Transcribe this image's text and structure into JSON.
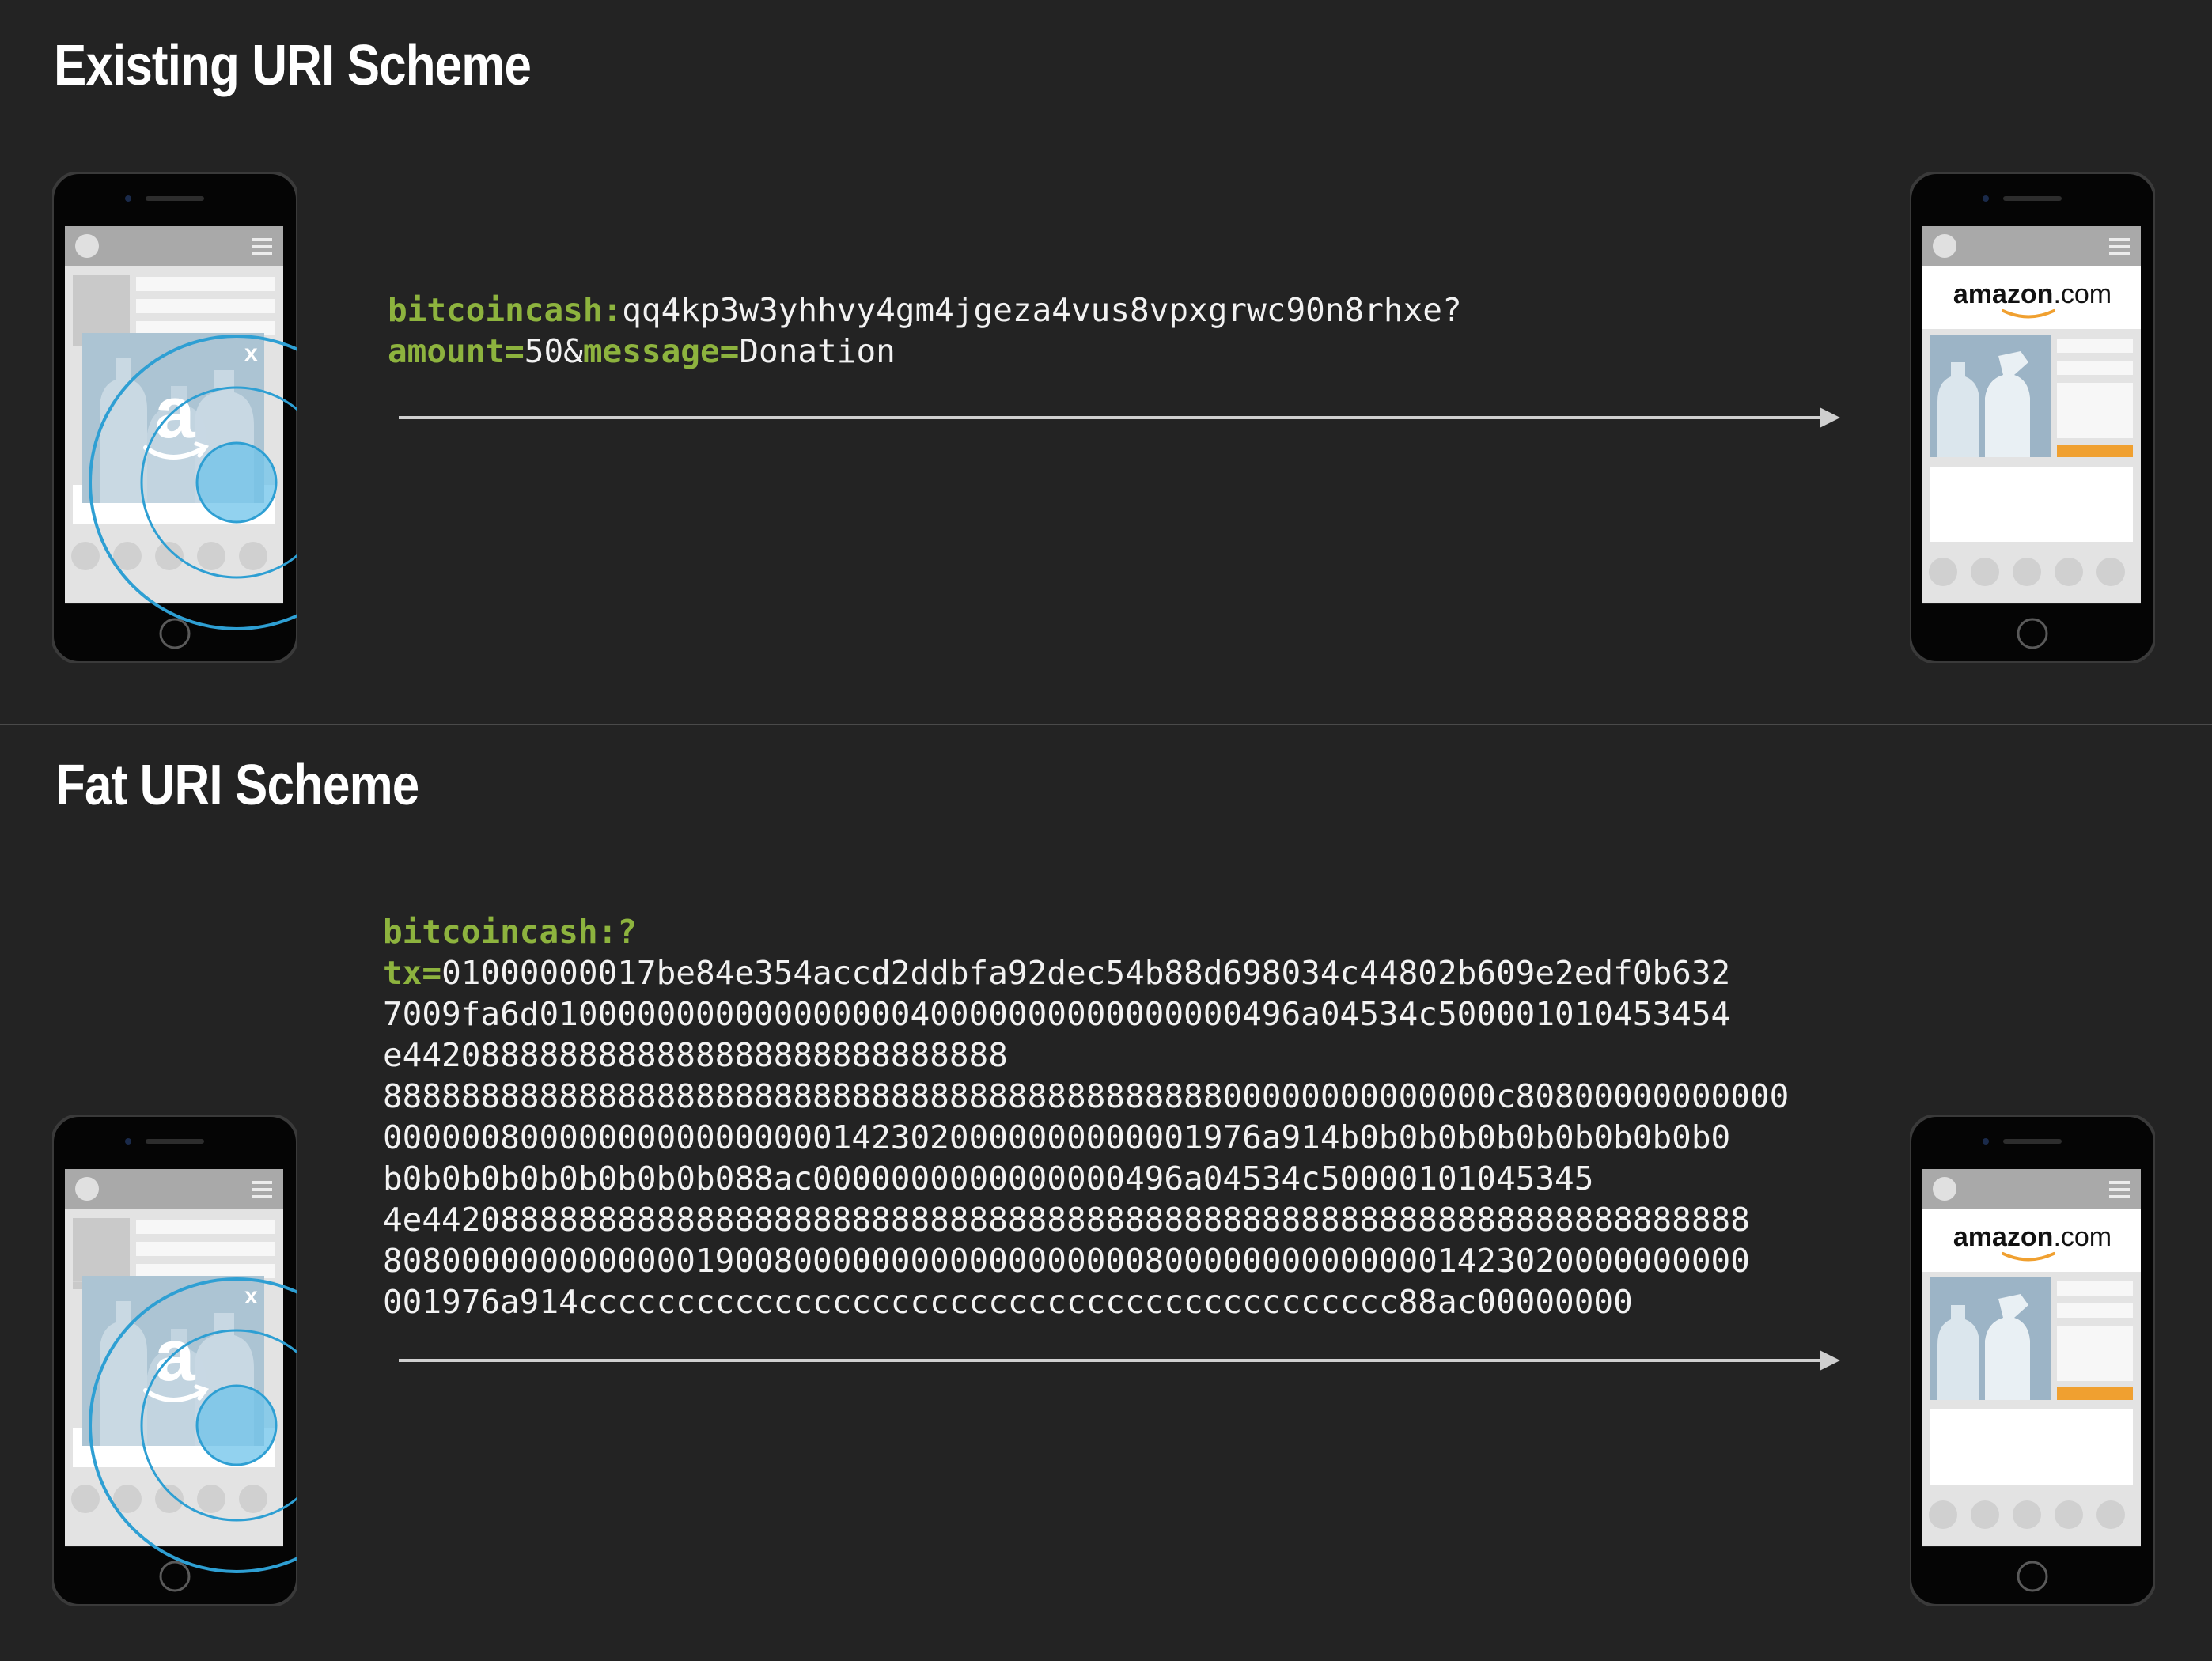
{
  "existing": {
    "title": "Existing URI Scheme",
    "uri_scheme": "bitcoincash:",
    "uri_address": "qq4kp3w3yhhvy4gm4jgeza4vus8vpxgrwc90n8rhxe?",
    "uri_amount_key": "amount=",
    "uri_amount_value": "50&",
    "uri_message_key": "message=",
    "uri_message_value": "Donation"
  },
  "fat": {
    "title": "Fat URI Scheme",
    "uri_scheme": "bitcoincash:?",
    "uri_tx_key": "tx=",
    "uri_tx_lines": [
      "01000000017be84e354accd2ddbfa92dec54b88d698034c44802b609e2edf0b632",
      "7009fa6d010000000000000000040000000000000000496a04534c500001010453454",
      "e4420888888888888888888888888888",
      "888888888888888888888888888888888888888888800000000000000c80800000000000",
      "000000800000000000000001423020000000000001976a914b0b0b0b0b0b0b0b0b0b0",
      "b0b0b0b0b0b0b0b0b088ac0000000000000000496a04534c50000101045345",
      "4e44208888888888888888888888888888888888888888888888888888888888888888",
      "8080000000000000190080000000000000000008000000000000001423020000000000",
      "001976a914cccccccccccccccccccccccccccccccccccccccccc88ac00000000"
    ]
  },
  "merchant_logo": {
    "brand": "amazon",
    "suffix": ".com"
  },
  "ad_close_label": "x",
  "colors": {
    "background": "#232323",
    "keyword_green": "#8db33e",
    "tap_ring_blue": "#2e9fd3",
    "buy_button_orange": "#f0a030",
    "arrow_grey": "#cfcfcf"
  }
}
